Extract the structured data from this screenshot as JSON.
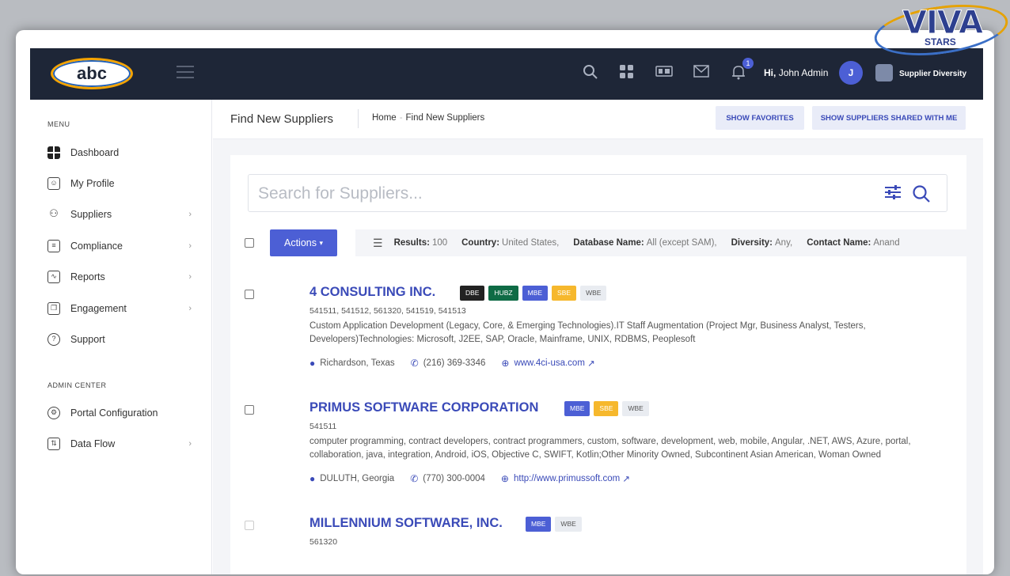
{
  "colors": {
    "topbar": "#1e2637",
    "accent": "#4c5fd5",
    "link": "#3a4ab8",
    "badge_dbe": "#222222",
    "badge_hubz": "#0f6b45",
    "badge_mbe": "#4c5fd5",
    "badge_sbe": "#f6b82d",
    "badge_wbe": "#e9ecf1"
  },
  "topbar": {
    "logo_text": "abc",
    "icons": [
      "search-icon",
      "apps-grid-icon",
      "id-card-icon",
      "mail-icon",
      "bell-icon"
    ],
    "notification_count": "1",
    "greeting_prefix": "Hi,",
    "user_name": "John Admin",
    "avatar_initial": "J",
    "partner_label": "Supplier Diversity"
  },
  "watermark": {
    "word": "VIVA",
    "sub": "STARS"
  },
  "sidebar": {
    "menu_heading": "MENU",
    "items": [
      {
        "label": "Dashboard",
        "icon": "dashboard-icon"
      },
      {
        "label": "My Profile",
        "icon": "profile-icon"
      },
      {
        "label": "Suppliers",
        "icon": "suppliers-icon"
      },
      {
        "label": "Compliance",
        "icon": "compliance-icon"
      },
      {
        "label": "Reports",
        "icon": "reports-icon"
      },
      {
        "label": "Engagement",
        "icon": "engagement-icon"
      },
      {
        "label": "Support",
        "icon": "support-icon"
      }
    ],
    "admin_heading": "ADMIN CENTER",
    "admin_items": [
      {
        "label": "Portal Configuration",
        "icon": "settings-icon"
      },
      {
        "label": "Data Flow",
        "icon": "data-flow-icon"
      }
    ]
  },
  "header": {
    "title": "Find New Suppliers",
    "breadcrumb_home": "Home",
    "breadcrumb_sep": "-",
    "breadcrumb_current": "Find New Suppliers",
    "show_favorites": "SHOW FAVORITES",
    "show_shared": "SHOW SUPPLIERS SHARED WITH ME"
  },
  "search": {
    "placeholder": "Search for Suppliers..."
  },
  "filters": {
    "actions_label": "Actions",
    "results_label": "Results:",
    "results_value": "100",
    "country_label": "Country:",
    "country_value": "United States,",
    "database_label": "Database Name:",
    "database_value": "All (except SAM),",
    "diversity_label": "Diversity:",
    "diversity_value": "Any,",
    "contact_label": "Contact Name:",
    "contact_value": "Anand"
  },
  "results": [
    {
      "name": "4 CONSULTING INC.",
      "badges": [
        "DBE",
        "HUBZ",
        "MBE",
        "SBE",
        "WBE"
      ],
      "naics": "541511, 541512, 561320, 541519, 541513",
      "description": "Custom Application Development (Legacy, Core, & Emerging Technologies).IT Staff Augmentation (Project Mgr, Business Analyst, Testers, Developers)Technologies: Microsoft, J2EE, SAP, Oracle, Mainframe, UNIX, RDBMS, Peoplesoft",
      "location": "Richardson, Texas",
      "phone": "(216) 369-3346",
      "website": "www.4ci-usa.com"
    },
    {
      "name": "PRIMUS SOFTWARE CORPORATION",
      "badges": [
        "MBE",
        "SBE",
        "WBE"
      ],
      "naics": "541511",
      "description": "computer programming, contract developers, contract programmers, custom, software, development, web, mobile, Angular, .NET, AWS, Azure, portal, collaboration, java, integration, Android, iOS, Objective C, SWIFT, Kotlin;Other Minority Owned, Subcontinent Asian American, Woman Owned",
      "location": "DULUTH, Georgia",
      "phone": "(770) 300-0004",
      "website": "http://www.primussoft.com"
    },
    {
      "name": "MILLENNIUM SOFTWARE, INC.",
      "badges": [
        "MBE",
        "WBE"
      ],
      "naics": "561320"
    }
  ]
}
